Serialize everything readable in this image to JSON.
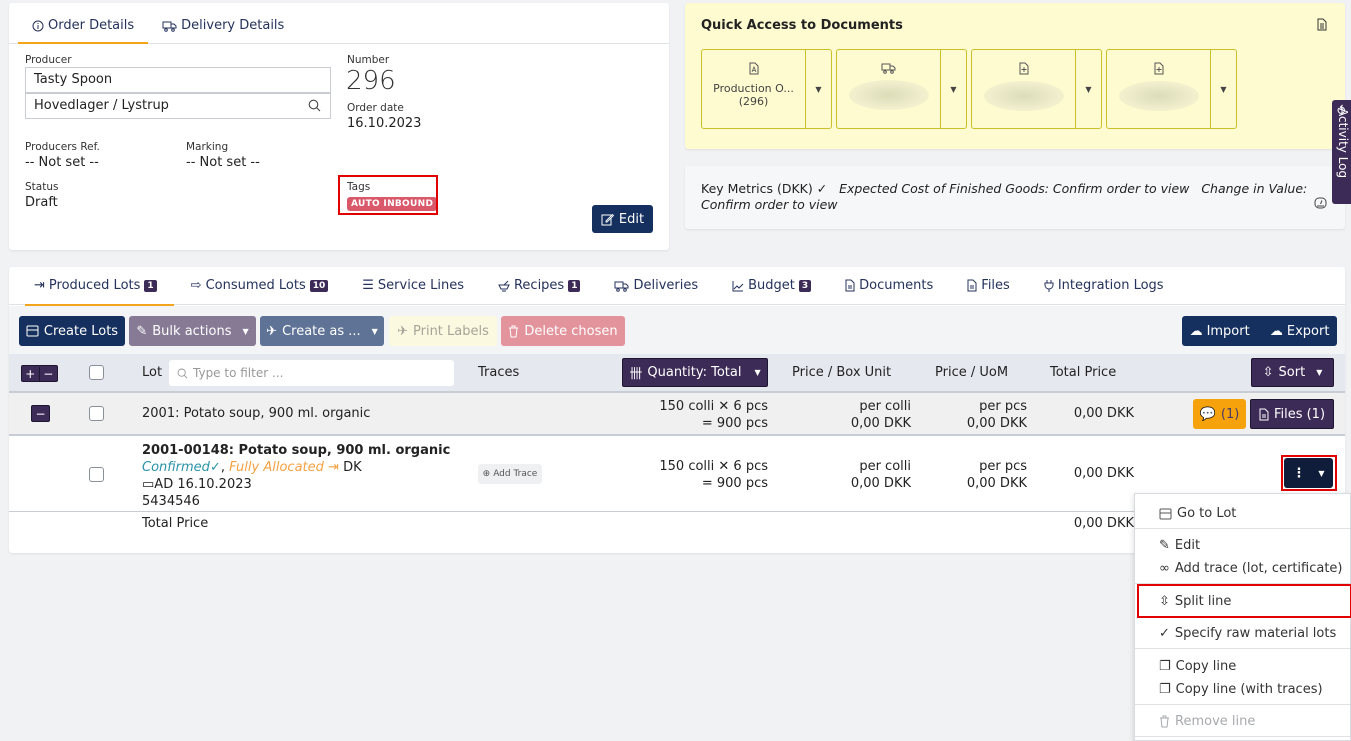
{
  "order_card": {
    "tabs": [
      {
        "label": "Order Details",
        "icon": "info-circle-icon",
        "active": true
      },
      {
        "label": "Delivery Details",
        "icon": "truck-icon",
        "active": false
      }
    ],
    "producer_label": "Producer",
    "producer_value": "Tasty Spoon",
    "location_value": "Hovedlager / Lystrup",
    "number_label": "Number",
    "number_value": "296",
    "order_date_label": "Order date",
    "order_date_value": "16.10.2023",
    "producers_ref_label": "Producers Ref.",
    "producers_ref_value": "-- Not set --",
    "marking_label": "Marking",
    "marking_value": "-- Not set --",
    "status_label": "Status",
    "status_value": "Draft",
    "tags_label": "Tags",
    "tags": [
      "AUTO INBOUND"
    ],
    "edit_label": "Edit"
  },
  "quick_access": {
    "title": "Quick Access to Documents",
    "tiles": [
      {
        "icon": "pdf-file-icon",
        "label": "Production O...",
        "sub": "(296)"
      },
      {
        "icon": "truck-icon",
        "label": "",
        "sub": ""
      },
      {
        "icon": "file-plus-icon",
        "label": "",
        "sub": ""
      },
      {
        "icon": "file-plus-icon",
        "label": "",
        "sub": ""
      }
    ]
  },
  "key_metrics": {
    "label": "Key Metrics (DKK) ✓",
    "expected": "Expected Cost of Finished Goods: Confirm order to view",
    "change": "Change in Value: Confirm order to view"
  },
  "activity_log": "Activity Log",
  "lots": {
    "tabs": [
      {
        "label": "Produced Lots",
        "count": "1",
        "icon": "sign-in-icon",
        "active": true
      },
      {
        "label": "Consumed Lots",
        "count": "10",
        "icon": "sign-out-icon"
      },
      {
        "label": "Service Lines",
        "count": null,
        "icon": "list-icon"
      },
      {
        "label": "Recipes",
        "count": "1",
        "icon": "mortar-icon"
      },
      {
        "label": "Deliveries",
        "count": null,
        "icon": "truck-icon"
      },
      {
        "label": "Budget",
        "count": "3",
        "icon": "chart-line-icon"
      },
      {
        "label": "Documents",
        "count": null,
        "icon": "document-icon"
      },
      {
        "label": "Files",
        "count": null,
        "icon": "file-icon"
      },
      {
        "label": "Integration Logs",
        "count": null,
        "icon": "plug-icon"
      }
    ],
    "toolbar": {
      "create_lots": "Create Lots",
      "bulk_actions": "Bulk actions",
      "create_as": "Create as ...",
      "print_labels": "Print Labels",
      "delete_chosen": "Delete chosen",
      "import": "Import",
      "export": "Export"
    },
    "columns": {
      "lot": "Lot",
      "filter_placeholder": "Type to filter ...",
      "traces": "Traces",
      "quantity": "Quantity: Total",
      "price_box": "Price / Box Unit",
      "price_uom": "Price / UoM",
      "total_price": "Total Price",
      "sort": "Sort"
    },
    "group": {
      "title": "2001: Potato soup, 900 ml. organic",
      "qty_line1": "150 colli ✕ 6 pcs",
      "qty_line2": "= 900 pcs",
      "price_box_1": "per colli",
      "price_box_2": "0,00 DKK",
      "price_uom_1": "per pcs",
      "price_uom_2": "0,00 DKK",
      "total": "0,00 DKK",
      "comments": "(1)",
      "files": "Files (1)"
    },
    "item": {
      "title": "2001-00148: Potato soup, 900 ml. organic",
      "confirmed": "Confirmed",
      "allocated": "Fully Allocated",
      "country": "DK",
      "date": "AD 16.10.2023",
      "code": "5434546",
      "add_trace": "Add Trace",
      "qty_line1": "150 colli ✕ 6 pcs",
      "qty_line2": "= 900 pcs",
      "price_box_1": "per colli",
      "price_box_2": "0,00 DKK",
      "price_uom_1": "per pcs",
      "price_uom_2": "0,00 DKK",
      "total": "0,00 DKK"
    },
    "total_row": {
      "label": "Total Price",
      "value": "0,00 DKK"
    }
  },
  "row_menu": {
    "items": [
      {
        "label": "Go to Lot",
        "icon": "box-icon"
      },
      {
        "label": "Edit",
        "icon": "edit-icon"
      },
      {
        "label": "Add trace (lot, certificate)",
        "icon": "link-trace-icon"
      },
      {
        "label": "Split line",
        "icon": "split-icon",
        "highlighted": true
      },
      {
        "label": "Specify raw material lots",
        "icon": "check-icon"
      },
      {
        "label": "Copy line",
        "icon": "copy-icon"
      },
      {
        "label": "Copy line (with traces)",
        "icon": "copy-icon"
      },
      {
        "label": "Remove line",
        "icon": "trash-icon",
        "disabled": true
      }
    ]
  },
  "colors": {
    "navy": "#15305e",
    "purple": "#3d2b57",
    "accent": "#f1a41c",
    "tag": "#d9596a",
    "confirmed": "#2b93a8",
    "allocated": "#f5a143"
  }
}
